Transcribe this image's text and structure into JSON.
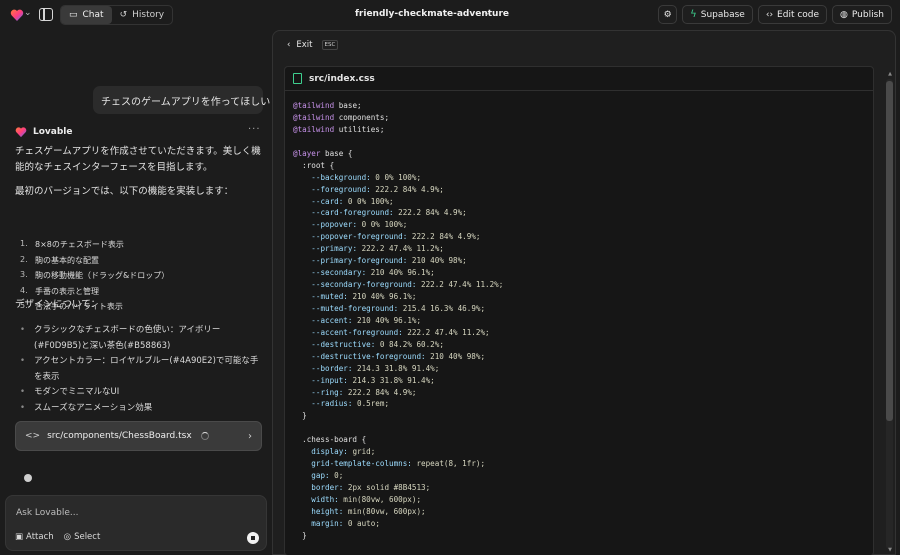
{
  "header": {
    "tabs": [
      {
        "label": "Chat",
        "active": true
      },
      {
        "label": "History",
        "active": false
      }
    ],
    "project_title": "friendly-checkmate-adventure",
    "buttons": {
      "supabase": "Supabase",
      "edit_code": "Edit code",
      "publish": "Publish"
    },
    "icons": [
      "lovable-logo-icon",
      "sidebar-toggle-icon",
      "chat-icon",
      "history-icon",
      "chevron-down-icon",
      "gear-icon",
      "bolt-icon",
      "code-icon",
      "globe-icon"
    ]
  },
  "chat": {
    "user_message": "チェスのゲームアプリを作ってほしい",
    "assistant_name": "Lovable",
    "intro": "チェスゲームアプリを作成させていただきます。美しく機能的なチェスインターフェースを目指します。",
    "first_version": "最初のバージョンでは、以下の機能を実装します：",
    "features": [
      "8×8のチェスボード表示",
      "駒の基本的な配置",
      "駒の移動機能（ドラッグ&ドロップ）",
      "手番の表示と管理",
      "合法手のハイライト表示"
    ],
    "design_heading": "デザインについて：",
    "design_points": [
      "クラシックなチェスボードの色使い：アイボリー(#F0D9B5)と深い茶色(#B58863)",
      "アクセントカラー：ロイヤルブルー(#4A90E2)で可能な手を表示",
      "モダンでミニマルなUI",
      "スムーズなアニメーション効果"
    ],
    "file_card": "src/components/ChessBoard.tsx",
    "composer_placeholder": "Ask Lovable...",
    "attach_label": "Attach",
    "select_label": "Select"
  },
  "code_panel": {
    "exit_label": "Exit",
    "esc_label": "ESC",
    "file_name": "src/index.css",
    "lines": [
      "@tailwind base;",
      "@tailwind components;",
      "@tailwind utilities;",
      "",
      "@layer base {",
      "  :root {",
      "    --background: 0 0% 100%;",
      "    --foreground: 222.2 84% 4.9%;",
      "    --card: 0 0% 100%;",
      "    --card-foreground: 222.2 84% 4.9%;",
      "    --popover: 0 0% 100%;",
      "    --popover-foreground: 222.2 84% 4.9%;",
      "    --primary: 222.2 47.4% 11.2%;",
      "    --primary-foreground: 210 40% 98%;",
      "    --secondary: 210 40% 96.1%;",
      "    --secondary-foreground: 222.2 47.4% 11.2%;",
      "    --muted: 210 40% 96.1%;",
      "    --muted-foreground: 215.4 16.3% 46.9%;",
      "    --accent: 210 40% 96.1%;",
      "    --accent-foreground: 222.2 47.4% 11.2%;",
      "    --destructive: 0 84.2% 60.2%;",
      "    --destructive-foreground: 210 40% 98%;",
      "    --border: 214.3 31.8% 91.4%;",
      "    --input: 214.3 31.8% 91.4%;",
      "    --ring: 222.2 84% 4.9%;",
      "    --radius: 0.5rem;",
      "  }",
      "",
      "  .chess-board {",
      "    display: grid;",
      "    grid-template-columns: repeat(8, 1fr);",
      "    gap: 0;",
      "    border: 2px solid #8B4513;",
      "    width: min(80vw, 600px);",
      "    height: min(80vw, 600px);",
      "    margin: 0 auto;",
      "  }"
    ]
  },
  "colors": {
    "accent_green": "#3ecf8e",
    "background": "#1c1c1c"
  }
}
